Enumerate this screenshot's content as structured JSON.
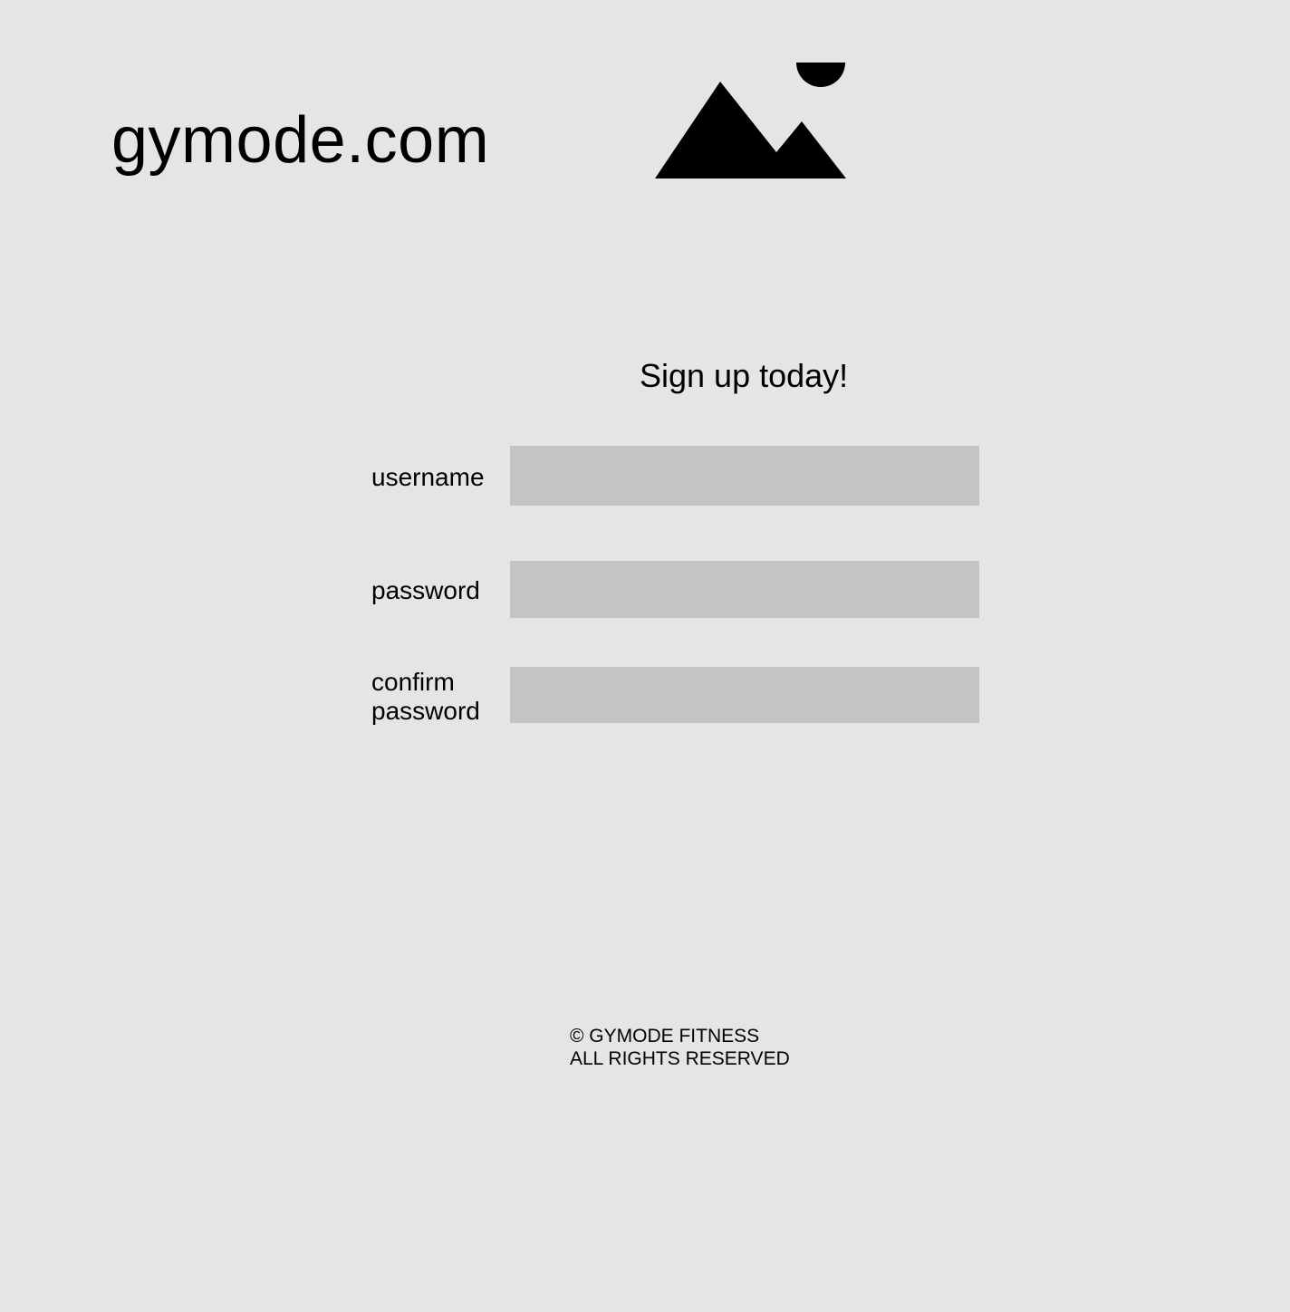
{
  "header": {
    "site_title": "gymode.com",
    "logo_icon": "image-placeholder-icon"
  },
  "signup": {
    "heading": "Sign up today!",
    "fields": {
      "username": {
        "label": "username",
        "value": "",
        "placeholder": ""
      },
      "password": {
        "label": "password",
        "value": "",
        "placeholder": ""
      },
      "confirm_password": {
        "label_line1": "confirm",
        "label_line2": "password",
        "value": "",
        "placeholder": ""
      }
    }
  },
  "footer": {
    "line1": "© GYMODE FITNESS",
    "line2": "ALL RIGHTS RESERVED"
  },
  "colors": {
    "background": "#e5e5e5",
    "input_fill": "#c4c4c4",
    "text": "#000000"
  }
}
